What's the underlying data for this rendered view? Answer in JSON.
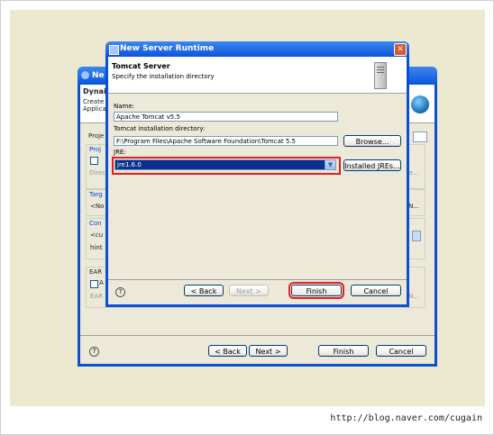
{
  "footer": {
    "url": "http://blog.naver.com/cugain"
  },
  "back_dialog": {
    "title_fragment": "Ne",
    "header_fragment": "Dynai",
    "desc_fragments": [
      "Create",
      "Applica"
    ],
    "left_fragments": [
      "Proje",
      "Proj",
      "Direc",
      "Targ",
      "<No",
      "Con",
      "<cu",
      "hint",
      "EAR",
      "A",
      "EAR"
    ],
    "right_fragments": [
      "e...",
      "N...",
      "N..."
    ],
    "buttons": {
      "back": "< Back",
      "next": "Next >",
      "finish": "Finish",
      "cancel": "Cancel"
    },
    "help": "?"
  },
  "dialog": {
    "title": "New Server Runtime",
    "close": "✕",
    "header_title": "Tomcat Server",
    "header_subtitle": "Specify the installation directory",
    "name_label": "Name:",
    "name_value": "Apache Tomcat v5.5",
    "install_label": "Tomcat installation directory:",
    "install_value": "F:\\Program Files\\Apache Software Foundation\\Tomcat 5.5",
    "browse_button": "Browse...",
    "jre_label": "JRE:",
    "jre_value": "jre1.6.0",
    "jre_arrow": "▼",
    "installed_jres_button": "Installed JREs...",
    "help": "?",
    "buttons": {
      "back": "< Back",
      "next": "Next >",
      "finish": "Finish",
      "cancel": "Cancel"
    }
  }
}
